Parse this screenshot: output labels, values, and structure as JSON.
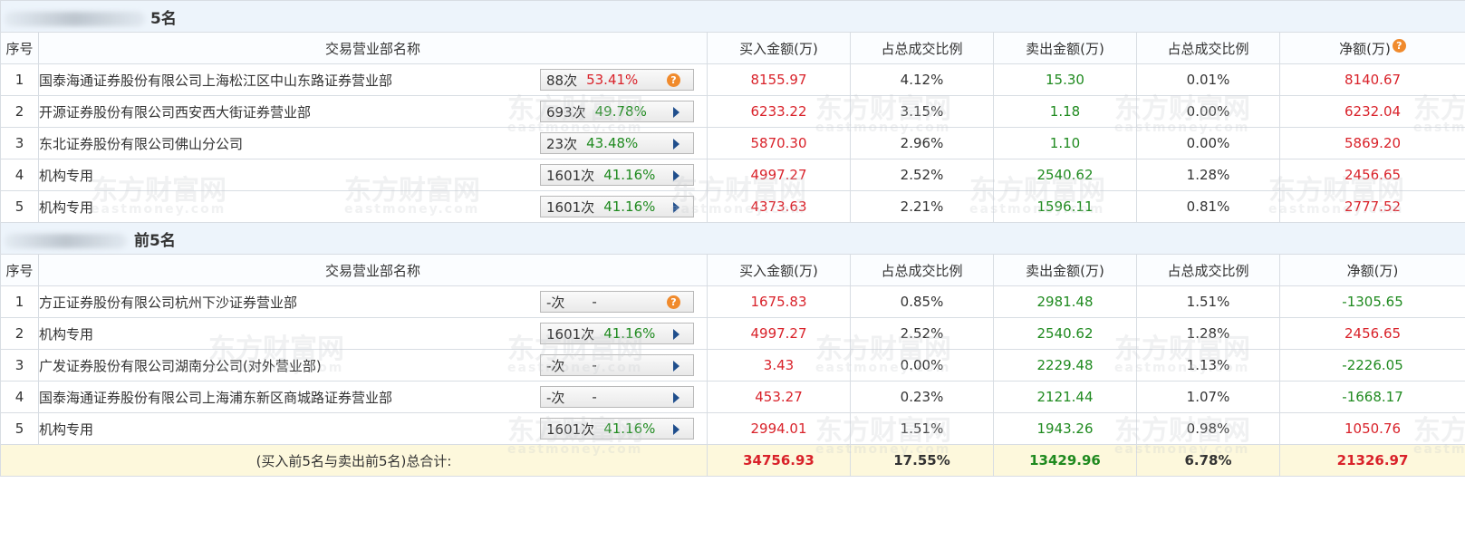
{
  "headers": {
    "seq": "序号",
    "dept": "交易营业部名称",
    "buy": "买入金额(万)",
    "buy_ratio": "占总成交比例",
    "sell": "卖出金额(万)",
    "sell_ratio": "占总成交比例",
    "net": "净额(万)"
  },
  "buy_section": {
    "title": "5名",
    "rows": [
      {
        "seq": "1",
        "name": "国泰海通证券股份有限公司上海松江区中山东路证券营业部",
        "count": "88次",
        "rate": "53.41%",
        "rate_color": "red",
        "icon": "question-icon",
        "buy": "8155.97",
        "buy_ratio": "4.12%",
        "sell": "15.30",
        "sell_ratio": "0.01%",
        "net": "8140.67",
        "net_color": "red"
      },
      {
        "seq": "2",
        "name": "开源证券股份有限公司西安西大街证券营业部",
        "count": "693次",
        "rate": "49.78%",
        "rate_color": "green",
        "icon": "arrow-right-icon",
        "buy": "6233.22",
        "buy_ratio": "3.15%",
        "sell": "1.18",
        "sell_ratio": "0.00%",
        "net": "6232.04",
        "net_color": "red"
      },
      {
        "seq": "3",
        "name": "东北证券股份有限公司佛山分公司",
        "count": "23次",
        "rate": "43.48%",
        "rate_color": "green",
        "icon": "arrow-right-icon",
        "buy": "5870.30",
        "buy_ratio": "2.96%",
        "sell": "1.10",
        "sell_ratio": "0.00%",
        "net": "5869.20",
        "net_color": "red"
      },
      {
        "seq": "4",
        "name": "机构专用",
        "count": "1601次",
        "rate": "41.16%",
        "rate_color": "green",
        "icon": "arrow-right-icon",
        "buy": "4997.27",
        "buy_ratio": "2.52%",
        "sell": "2540.62",
        "sell_ratio": "1.28%",
        "net": "2456.65",
        "net_color": "red"
      },
      {
        "seq": "5",
        "name": "机构专用",
        "count": "1601次",
        "rate": "41.16%",
        "rate_color": "green",
        "icon": "arrow-right-icon",
        "buy": "4373.63",
        "buy_ratio": "2.21%",
        "sell": "1596.11",
        "sell_ratio": "0.81%",
        "net": "2777.52",
        "net_color": "red"
      }
    ]
  },
  "sell_section": {
    "title": "前5名",
    "rows": [
      {
        "seq": "1",
        "name": "方正证券股份有限公司杭州下沙证券营业部",
        "count": "-次",
        "rate": "-",
        "rate_color": "gray",
        "icon": "question-icon",
        "buy": "1675.83",
        "buy_ratio": "0.85%",
        "sell": "2981.48",
        "sell_ratio": "1.51%",
        "net": "-1305.65",
        "net_color": "green"
      },
      {
        "seq": "2",
        "name": "机构专用",
        "count": "1601次",
        "rate": "41.16%",
        "rate_color": "green",
        "icon": "arrow-right-icon",
        "buy": "4997.27",
        "buy_ratio": "2.52%",
        "sell": "2540.62",
        "sell_ratio": "1.28%",
        "net": "2456.65",
        "net_color": "red"
      },
      {
        "seq": "3",
        "name": "广发证券股份有限公司湖南分公司(对外营业部)",
        "count": "-次",
        "rate": "-",
        "rate_color": "gray",
        "icon": "arrow-right-icon",
        "buy": "3.43",
        "buy_ratio": "0.00%",
        "sell": "2229.48",
        "sell_ratio": "1.13%",
        "net": "-2226.05",
        "net_color": "green"
      },
      {
        "seq": "4",
        "name": "国泰海通证券股份有限公司上海浦东新区商城路证券营业部",
        "count": "-次",
        "rate": "-",
        "rate_color": "gray",
        "icon": "arrow-right-icon",
        "buy": "453.27",
        "buy_ratio": "0.23%",
        "sell": "2121.44",
        "sell_ratio": "1.07%",
        "net": "-1668.17",
        "net_color": "green"
      },
      {
        "seq": "5",
        "name": "机构专用",
        "count": "1601次",
        "rate": "41.16%",
        "rate_color": "green",
        "icon": "arrow-right-icon",
        "buy": "2994.01",
        "buy_ratio": "1.51%",
        "sell": "1943.26",
        "sell_ratio": "0.98%",
        "net": "1050.76",
        "net_color": "red"
      }
    ]
  },
  "total": {
    "label": "(买入前5名与卖出前5名)总合计:",
    "buy": "34756.93",
    "buy_ratio": "17.55%",
    "sell": "13429.96",
    "sell_ratio": "6.78%",
    "net": "21326.97"
  },
  "watermark": {
    "cn": "东方财富网",
    "en": "eastmoney.com"
  },
  "colors": {
    "up": "#d9222a",
    "down": "#1f8a1f",
    "section_bg": "#edf4fb",
    "total_bg": "#fdf8dc",
    "accent_icon": "#f08a2c"
  }
}
